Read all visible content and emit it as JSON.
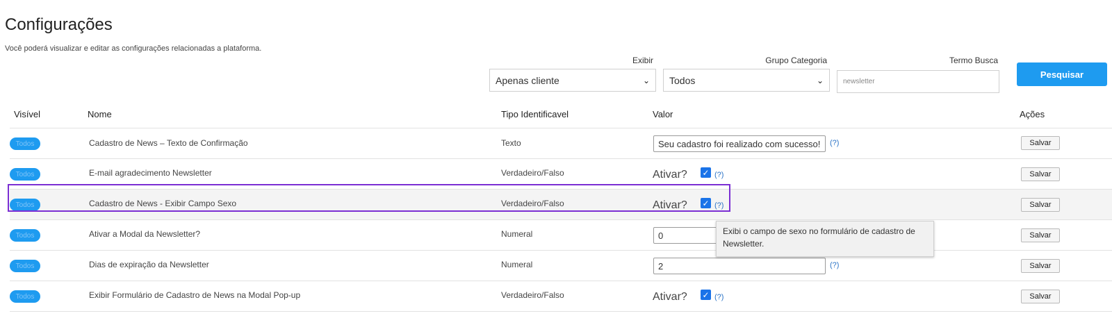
{
  "header": {
    "title": "Configurações",
    "subtitle": "Você poderá visualizar e editar as configurações relacionadas a plataforma."
  },
  "filters": {
    "exibir_label": "Exibir",
    "exibir_value": "Apenas cliente",
    "grupo_label": "Grupo Categoria",
    "grupo_value": "Todos",
    "termo_label": "Termo Busca",
    "termo_value": "newsletter",
    "search_label": "Pesquisar"
  },
  "table": {
    "headers": {
      "visivel": "Visível",
      "nome": "Nome",
      "tipo": "Tipo Identificavel",
      "valor": "Valor",
      "acoes": "Ações"
    },
    "badge": "Todos",
    "ativar_label": "Ativar?",
    "help_label": "(?)",
    "save_label": "Salvar",
    "rows": [
      {
        "nome": "Cadastro de News – Texto de Confirmação",
        "tipo": "Texto",
        "valor": "Seu cadastro foi realizado com sucesso!"
      },
      {
        "nome": "E-mail agradecimento Newsletter",
        "tipo": "Verdadeiro/Falso",
        "checked": true
      },
      {
        "nome": "Cadastro de News - Exibir Campo Sexo",
        "tipo": "Verdadeiro/Falso",
        "checked": true
      },
      {
        "nome": "Ativar a Modal da Newsletter?",
        "tipo": "Numeral",
        "valor": "0"
      },
      {
        "nome": "Dias de expiração da Newsletter",
        "tipo": "Numeral",
        "valor": "2"
      },
      {
        "nome": "Exibir Formulário de Cadastro de News na Modal Pop-up",
        "tipo": "Verdadeiro/Falso",
        "checked": true
      }
    ]
  },
  "tooltip": {
    "text": "Exibi o campo de sexo no formulário de cadastro de Newsletter."
  },
  "colors": {
    "accent": "#1e9bf0",
    "checkbox": "#1a73e8",
    "focus": "#7b2ed3"
  },
  "icons": {
    "select_arrow": "chevron-down-icon",
    "checkbox": "checkmark-icon"
  }
}
